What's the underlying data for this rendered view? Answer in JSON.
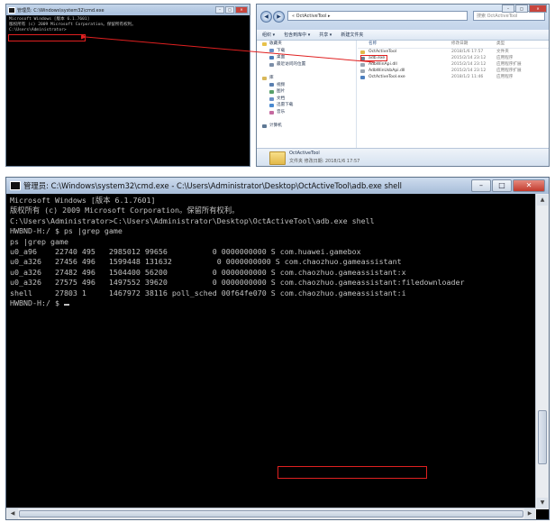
{
  "top_cmd": {
    "title": "管理员: C:\\Windows\\system32\\cmd.exe",
    "lines": [
      "Microsoft Windows [版本 6.1.7601]",
      "版权所有 (c) 2009 Microsoft Corporation。保留所有权利。",
      "",
      "C:\\Users\\Administrator>"
    ]
  },
  "explorer": {
    "address": "« OctActiveTool ▸",
    "search_placeholder": "搜索 OctActiveTool",
    "toolbar": [
      "组织 ▾",
      "包含到库中 ▾",
      "共享 ▾",
      "新建文件夹"
    ],
    "nav_items": [
      {
        "label": "收藏夹",
        "color": "#e8c24a"
      },
      {
        "label": "下载",
        "color": "#6a8fc7"
      },
      {
        "label": "桌面",
        "color": "#4a7ab8"
      },
      {
        "label": "最近访问的位置",
        "color": "#7b8ea8"
      },
      {
        "label": "",
        "color": ""
      },
      {
        "label": "库",
        "color": "#d9b85a"
      },
      {
        "label": "视频",
        "color": "#5a7fb0"
      },
      {
        "label": "图片",
        "color": "#58a06a"
      },
      {
        "label": "文档",
        "color": "#6a8fc7"
      },
      {
        "label": "迅雷下载",
        "color": "#4a8ad0"
      },
      {
        "label": "音乐",
        "color": "#c56aa0"
      },
      {
        "label": "",
        "color": ""
      },
      {
        "label": "计算机",
        "color": "#5e7894"
      }
    ],
    "columns": [
      "名称",
      "修改日期",
      "类型"
    ],
    "files": [
      {
        "name": "OctActiveTool",
        "date": "2018/1/6 17:57",
        "type": "文件夹",
        "color": "#e2b84a"
      },
      {
        "name": "adb.exe",
        "date": "2015/2/14 23:12",
        "type": "应用程序",
        "color": "#6b7e93"
      },
      {
        "name": "AdbWinApi.dll",
        "date": "2015/2/14 23:12",
        "type": "应用程序扩展",
        "color": "#9aa5b2"
      },
      {
        "name": "AdbWinUsbApi.dll",
        "date": "2015/2/14 23:12",
        "type": "应用程序扩展",
        "color": "#9aa5b2"
      },
      {
        "name": "OctActiveTool.exe",
        "date": "2018/1/2 11:46",
        "type": "应用程序",
        "color": "#4d7fbf"
      }
    ],
    "status_name": "OctActiveTool",
    "status_info": "文件夹     修改日期: 2018/1/6 17:57"
  },
  "bottom_cmd": {
    "title": "管理员: C:\\Windows\\system32\\cmd.exe - C:\\Users\\Administrator\\Desktop\\OctActiveTool\\adb.exe  shell",
    "lines": [
      "Microsoft Windows [版本 6.1.7601]",
      "版权所有 (c) 2009 Microsoft Corporation。保留所有权利。",
      "",
      "C:\\Users\\Administrator>C:\\Users\\Administrator\\Desktop\\OctActiveTool\\adb.exe shell",
      "HWBND-H:/ $ ps |grep game",
      "ps |grep game",
      "u0_a96    22740 495   2985012 99656          0 0000000000 S com.huawei.gamebox",
      "u0_a326   27456 496   1599448 131632          0 0000000000 S com.chaozhuo.gameassistant",
      "u0_a326   27482 496   1504400 56200          0 0000000000 S com.chaozhuo.gameassistant:x",
      "u0_a326   27575 496   1497552 39620          0 0000000000 S com.chaozhuo.gameassistant:filedownloader",
      "shell     27803 1     1467972 38116 poll_sched 00f64fe070 S com.chaozhuo.gameassistant:i",
      "HWBND-H:/ $ "
    ]
  }
}
